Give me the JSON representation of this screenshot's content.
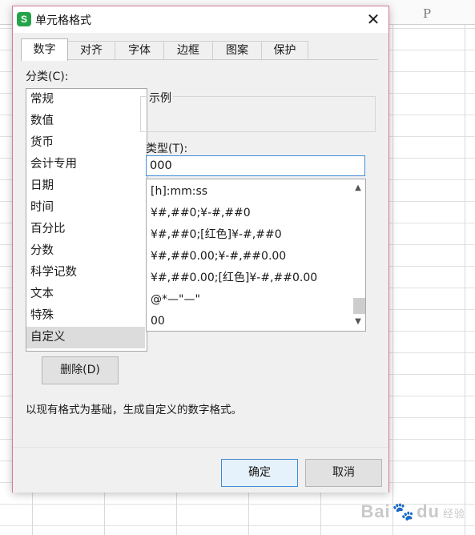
{
  "spreadsheet": {
    "column_letter": "P",
    "watermark_text": "Bai",
    "watermark_sub": "经验",
    "watermark_suffix": "du"
  },
  "dialog": {
    "title": "单元格格式",
    "app_icon_letter": "S",
    "close_glyph": "✕",
    "tabs": [
      {
        "label": "数字"
      },
      {
        "label": "对齐"
      },
      {
        "label": "字体"
      },
      {
        "label": "边框"
      },
      {
        "label": "图案"
      },
      {
        "label": "保护"
      }
    ],
    "active_tab": "数字",
    "category_label": "分类(C):",
    "categories": [
      {
        "label": "常规"
      },
      {
        "label": "数值"
      },
      {
        "label": "货币"
      },
      {
        "label": "会计专用"
      },
      {
        "label": "日期"
      },
      {
        "label": "时间"
      },
      {
        "label": "百分比"
      },
      {
        "label": "分数"
      },
      {
        "label": "科学记数"
      },
      {
        "label": "文本"
      },
      {
        "label": "特殊"
      },
      {
        "label": "自定义"
      }
    ],
    "selected_category": "自定义",
    "sample_label": "示例",
    "type_label": "类型(T):",
    "type_value": "000",
    "formats": [
      {
        "label": "[h]:mm:ss"
      },
      {
        "label": "¥#,##0;¥-#,##0"
      },
      {
        "label": "¥#,##0;[红色]¥-#,##0"
      },
      {
        "label": "¥#,##0.00;¥-#,##0.00"
      },
      {
        "label": "¥#,##0.00;[红色]¥-#,##0.00"
      },
      {
        "label": "@*—\"—\""
      },
      {
        "label": "00"
      }
    ],
    "delete_button": "删除(D)",
    "description": "以现有格式为基础，生成自定义的数字格式。",
    "ok_button": "确定",
    "cancel_button": "取消"
  },
  "colors": {
    "app_icon": "#25a34a",
    "dialog_border": "#d87893",
    "focus_blue": "#3f8dd8",
    "dialog_bg": "#f0f0f0"
  }
}
